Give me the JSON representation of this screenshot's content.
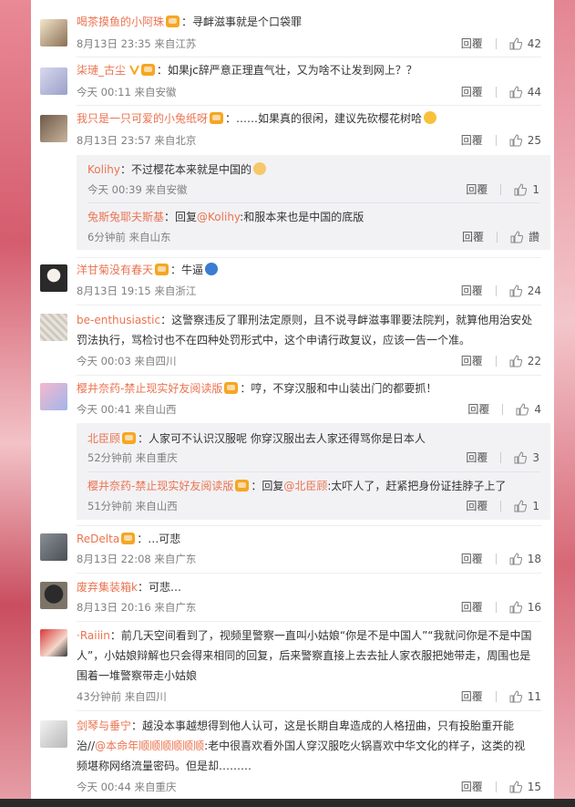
{
  "ops": {
    "reply": "回覆"
  },
  "comments": [
    {
      "name": "喝茶摸鱼的小阿珠",
      "text": "：寻衅滋事就是个口袋罪",
      "meta": "8月13日 23:35 来自江苏",
      "likes": "42"
    },
    {
      "name": "柒璉_古尘",
      "text": "：如果jc辞严意正理直气壮，又为啥不让发到网上？？",
      "meta": "今天 00:11 来自安徽",
      "likes": "44"
    },
    {
      "name": "我只是一只可爱的小兔纸呀",
      "text": "：……如果真的很闲，建议先砍樱花树哈",
      "meta": "8月13日 23:57 来自北京",
      "likes": "25",
      "replies": [
        {
          "name": "Kolihy",
          "text": "：不过樱花本来就是中国的",
          "meta": "今天 00:39 来自安徽",
          "likes": "1"
        },
        {
          "name": "兔斯兔耶夫斯基",
          "text_prefix": "：回复",
          "mention": "@Kolihy",
          "text": ":和服本来也是中国的底版",
          "meta": "6分钟前 来自山东",
          "likes": "讚"
        }
      ]
    },
    {
      "name": "洋甘菊没有春天",
      "text": "：牛逼",
      "meta": "8月13日 19:15 来自浙江",
      "likes": "24"
    },
    {
      "name": "be-enthusiastic",
      "text": "：这警察违反了罪刑法定原则，且不说寻衅滋事罪要法院判，就算他用治安处罚法执行，骂检讨也不在四种处罚形式中，这个申请行政复议，应该一告一个准。",
      "meta": "今天 00:03 来自四川",
      "likes": "22"
    },
    {
      "name": "樱井奈药-禁止现实好友阅读版",
      "text": "：哼，不穿汉服和中山装出门的都要抓！",
      "meta": "今天 00:41 来自山西",
      "likes": "4",
      "replies": [
        {
          "name": "北臣顾",
          "text": "：人家可不认识汉服呢 你穿汉服出去人家还得骂你是日本人",
          "meta": "52分钟前 来自重庆",
          "likes": "3"
        },
        {
          "name": "樱井奈药-禁止现实好友阅读版",
          "text_prefix": "：回复",
          "mention": "@北臣顾",
          "text": ":太吓人了，赶紧把身份证挂脖子上了",
          "meta": "51分钟前 来自山西",
          "likes": "1"
        }
      ]
    },
    {
      "name": "ReDelta",
      "text": "：…可悲",
      "meta": "8月13日 22:08 来自广东",
      "likes": "18"
    },
    {
      "name": "废弃集装箱k",
      "text": "：可悲…",
      "meta": "8月13日 20:16 来自广东",
      "likes": "16"
    },
    {
      "name": "·Raiiin",
      "text": "：前几天空间看到了，视频里警察一直叫小姑娘“你是不是中国人”“我就问你是不是中国人”，小姑娘辩解也只会得来相同的回复，后来警察直接上去去扯人家衣服把她带走，周围也是围着一堆警察带走小姑娘",
      "meta": "43分钟前 来自四川",
      "likes": "11"
    },
    {
      "name": "剑琴与垂宁",
      "text": "：越没本事越想得到他人认可，这是长期自卑造成的人格扭曲，只有投胎重开能治//",
      "mention": "@本命年顺顺顺顺顺顺",
      "text2": ":老中很喜欢看外国人穿汉服吃火锅喜欢中华文化的样子，这类的视频堪称网络流量密码。但是却………",
      "meta": "今天 00:44 来自重庆",
      "likes": "15"
    }
  ],
  "colors": {
    "name": "#eb7350",
    "meta": "#808080",
    "subbox": "#f2f2f5",
    "accent_bg": "#d77a86"
  },
  "icons": [
    "vip-badge-icon",
    "verified-icon",
    "emoji-icon",
    "thumb-up-icon"
  ]
}
